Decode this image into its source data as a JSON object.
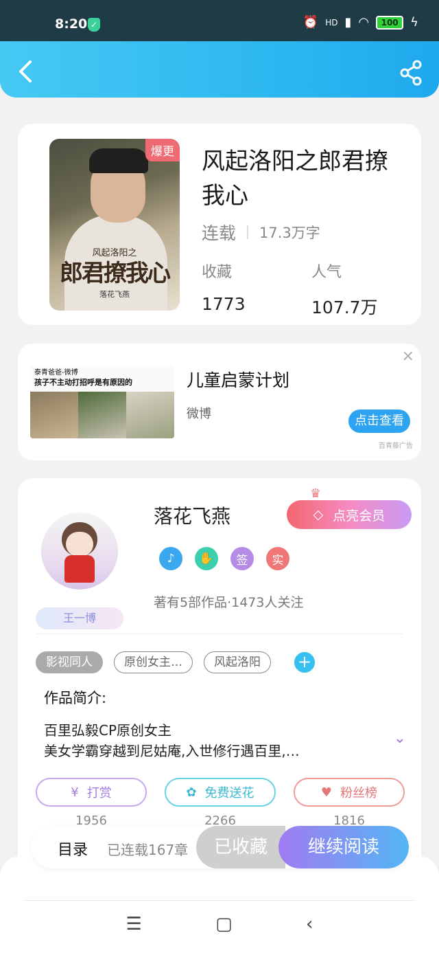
{
  "status_bar": {
    "time": "8:20",
    "shield": "✓",
    "hd_label": "HD",
    "battery": "100"
  },
  "book": {
    "title": "风起洛阳之郎君撩我心",
    "status": "连载",
    "word_count": "17.3万字",
    "hot_badge": "爆更",
    "cover_subtitle": "风起洛阳之",
    "cover_title": "郎君撩我心",
    "cover_author": "落花飞燕",
    "favorites_label": "收藏",
    "favorites_value": "1773",
    "popularity_label": "人气",
    "popularity_value": "107.7万"
  },
  "ad": {
    "title": "儿童启蒙计划",
    "source": "微博",
    "button": "点击查看",
    "tag": "百青藤广告",
    "close": "×",
    "img_account": "泰青爸爸-微博",
    "img_headline": "孩子不主动打招呼是有原因的"
  },
  "author": {
    "name": "落花飞燕",
    "vip_button": "点亮会员",
    "avatar_tag": "王一博",
    "works_info": "著有5部作品·1473人关注",
    "honors": [
      {
        "label": "♪",
        "color": "#3aa7ef"
      },
      {
        "label": "✋",
        "color": "#3ccfae"
      },
      {
        "label": "签",
        "color": "#b58be6"
      },
      {
        "label": "实",
        "color": "#f07777"
      }
    ],
    "tags": [
      "影视同人",
      "原创女主…",
      "风起洛阳"
    ],
    "tag_add": "+",
    "intro_label": "作品简介:",
    "intro_line1": "百里弘毅CP原创女主",
    "intro_line2": "美女学霸穿越到尼姑庵,入世修行遇百里,…",
    "actions": [
      {
        "label": "打赏",
        "icon": "¥",
        "count": "1956"
      },
      {
        "label": "免费送花",
        "icon": "✿",
        "count": "2266"
      },
      {
        "label": "粉丝榜",
        "icon": "♥",
        "count": "1816"
      }
    ]
  },
  "read_bar": {
    "toc": "目录",
    "progress": "已连载167章",
    "favorited": "已收藏",
    "continue": "继续阅读"
  },
  "nav": {
    "menu": "☰",
    "home": "▢",
    "back": "‹"
  }
}
